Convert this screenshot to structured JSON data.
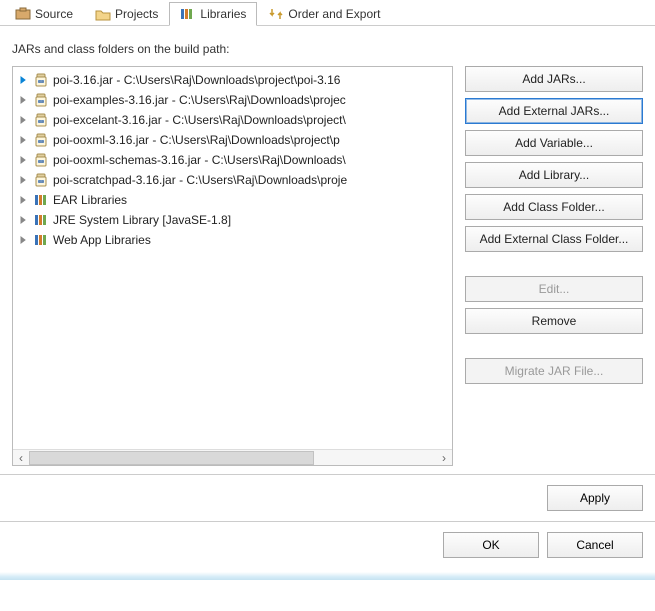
{
  "tabs": [
    {
      "label": "Source",
      "icon": "package-icon"
    },
    {
      "label": "Projects",
      "icon": "folder-icon"
    },
    {
      "label": "Libraries",
      "icon": "library-icon"
    },
    {
      "label": "Order and Export",
      "icon": "order-export-icon"
    }
  ],
  "active_tab": 2,
  "instruction": "JARs and class folders on the build path:",
  "tree": [
    {
      "label": "poi-3.16.jar - C:\\Users\\Raj\\Downloads\\project\\poi-3.16",
      "icon": "jar",
      "selected": true
    },
    {
      "label": "poi-examples-3.16.jar - C:\\Users\\Raj\\Downloads\\projec",
      "icon": "jar"
    },
    {
      "label": "poi-excelant-3.16.jar - C:\\Users\\Raj\\Downloads\\project\\",
      "icon": "jar"
    },
    {
      "label": "poi-ooxml-3.16.jar - C:\\Users\\Raj\\Downloads\\project\\p",
      "icon": "jar"
    },
    {
      "label": "poi-ooxml-schemas-3.16.jar - C:\\Users\\Raj\\Downloads\\",
      "icon": "jar"
    },
    {
      "label": "poi-scratchpad-3.16.jar - C:\\Users\\Raj\\Downloads\\proje",
      "icon": "jar"
    },
    {
      "label": "EAR Libraries",
      "icon": "lib"
    },
    {
      "label": "JRE System Library [JavaSE-1.8]",
      "icon": "lib"
    },
    {
      "label": "Web App Libraries",
      "icon": "lib"
    }
  ],
  "side_buttons": [
    {
      "label": "Add JARs...",
      "state": "normal"
    },
    {
      "label": "Add External JARs...",
      "state": "highlight"
    },
    {
      "label": "Add Variable...",
      "state": "normal"
    },
    {
      "label": "Add Library...",
      "state": "normal"
    },
    {
      "label": "Add Class Folder...",
      "state": "normal"
    },
    {
      "label": "Add External Class Folder...",
      "state": "normal"
    },
    {
      "label": "Edit...",
      "state": "disabled"
    },
    {
      "label": "Remove",
      "state": "normal"
    },
    {
      "label": "Migrate JAR File...",
      "state": "disabled"
    }
  ],
  "footer": {
    "apply": "Apply",
    "ok": "OK",
    "cancel": "Cancel"
  }
}
